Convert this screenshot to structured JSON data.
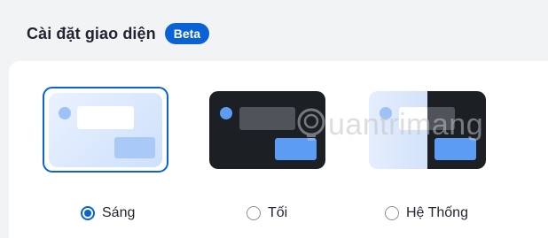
{
  "header": {
    "title": "Cài đặt giao diện",
    "badge": "Beta"
  },
  "themes": [
    {
      "id": "light",
      "label": "Sáng",
      "selected": true
    },
    {
      "id": "dark",
      "label": "Tối",
      "selected": false
    },
    {
      "id": "system",
      "label": "Hệ Thống",
      "selected": false
    }
  ],
  "watermark": {
    "text": "uantrimang",
    "icon": "lightbulb-icon"
  },
  "colors": {
    "accent": "#0a63d4",
    "panel": "#ffffff",
    "background": "#f2f3f5",
    "dark_thumb": "#1c1f24",
    "thumb_blue": "#5c9cf5"
  }
}
